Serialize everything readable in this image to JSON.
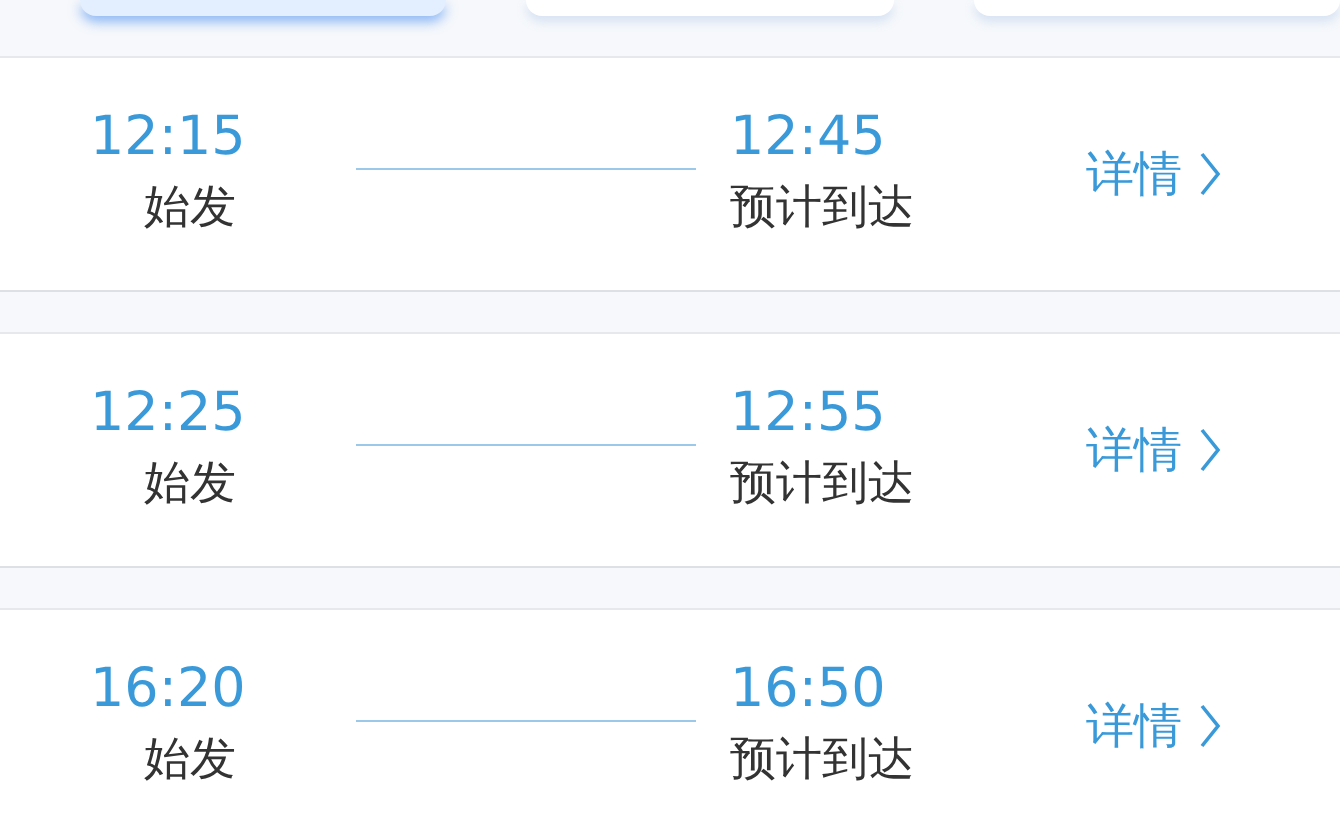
{
  "filter_buttons": [
    {
      "selected": true
    },
    {
      "selected": false
    },
    {
      "selected": false
    }
  ],
  "trips": [
    {
      "depart_time": "12:15",
      "depart_label": "始发",
      "arrive_time": "12:45",
      "arrive_label": "预计到达",
      "details": "详情"
    },
    {
      "depart_time": "12:25",
      "depart_label": "始发",
      "arrive_time": "12:55",
      "arrive_label": "预计到达",
      "details": "详情"
    },
    {
      "depart_time": "16:20",
      "depart_label": "始发",
      "arrive_time": "16:50",
      "arrive_label": "预计到达",
      "details": "详情"
    }
  ]
}
